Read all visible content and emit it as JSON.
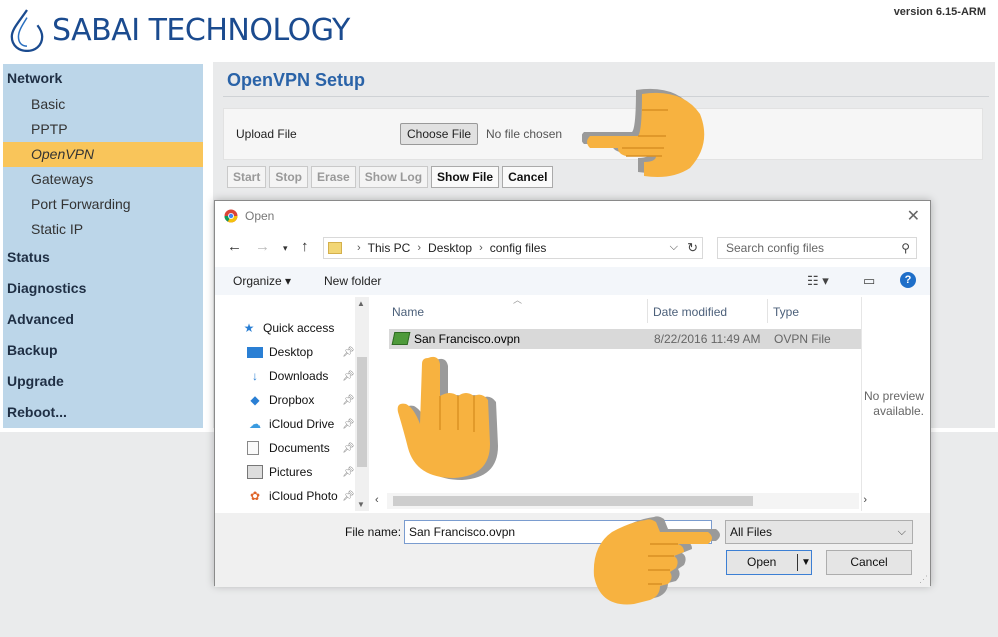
{
  "header": {
    "brand": "SABAI TECHNOLOGY",
    "version": "version 6.15-ARM",
    "brand_color": "#1b4b8f"
  },
  "sidebar": {
    "sections": [
      {
        "label": "Network"
      },
      {
        "label": "Status"
      },
      {
        "label": "Diagnostics"
      },
      {
        "label": "Advanced"
      },
      {
        "label": "Backup"
      },
      {
        "label": "Upgrade"
      },
      {
        "label": "Reboot..."
      }
    ],
    "network_items": [
      {
        "label": "Basic"
      },
      {
        "label": "PPTP"
      },
      {
        "label": "OpenVPN",
        "active": true
      },
      {
        "label": "Gateways"
      },
      {
        "label": "Port Forwarding"
      },
      {
        "label": "Static IP"
      }
    ],
    "active_color": "#f9c55a"
  },
  "main": {
    "title": "OpenVPN Setup",
    "upload_label": "Upload File",
    "choose_button": "Choose File",
    "no_file": "No file chosen",
    "buttons": {
      "start": "Start",
      "stop": "Stop",
      "erase": "Erase",
      "show_log": "Show Log",
      "show_file": "Show File",
      "cancel": "Cancel"
    }
  },
  "dialog": {
    "title": "Open",
    "breadcrumb": [
      "This PC",
      "Desktop",
      "config files"
    ],
    "search_placeholder": "Search config files",
    "toolbar": {
      "organize": "Organize ▾",
      "new_folder": "New folder"
    },
    "nav_items": [
      {
        "label": "Quick access",
        "icon": "star-icon"
      },
      {
        "label": "Desktop",
        "icon": "desktop-icon"
      },
      {
        "label": "Downloads",
        "icon": "download-icon"
      },
      {
        "label": "Dropbox",
        "icon": "dropbox-icon"
      },
      {
        "label": "iCloud Drive",
        "icon": "cloud-icon"
      },
      {
        "label": "Documents",
        "icon": "documents-icon"
      },
      {
        "label": "Pictures",
        "icon": "pictures-icon"
      },
      {
        "label": "iCloud Photo",
        "icon": "photos-icon"
      }
    ],
    "columns": {
      "name": "Name",
      "date": "Date modified",
      "type": "Type"
    },
    "files": [
      {
        "name": "San Francisco.ovpn",
        "date": "8/22/2016 11:49 AM",
        "type": "OVPN File"
      }
    ],
    "preview_text": "No preview available.",
    "file_name_label": "File name:",
    "file_name_value": "San Francisco.ovpn",
    "filter": "All Files",
    "open_button": "Open",
    "cancel_button": "Cancel"
  }
}
